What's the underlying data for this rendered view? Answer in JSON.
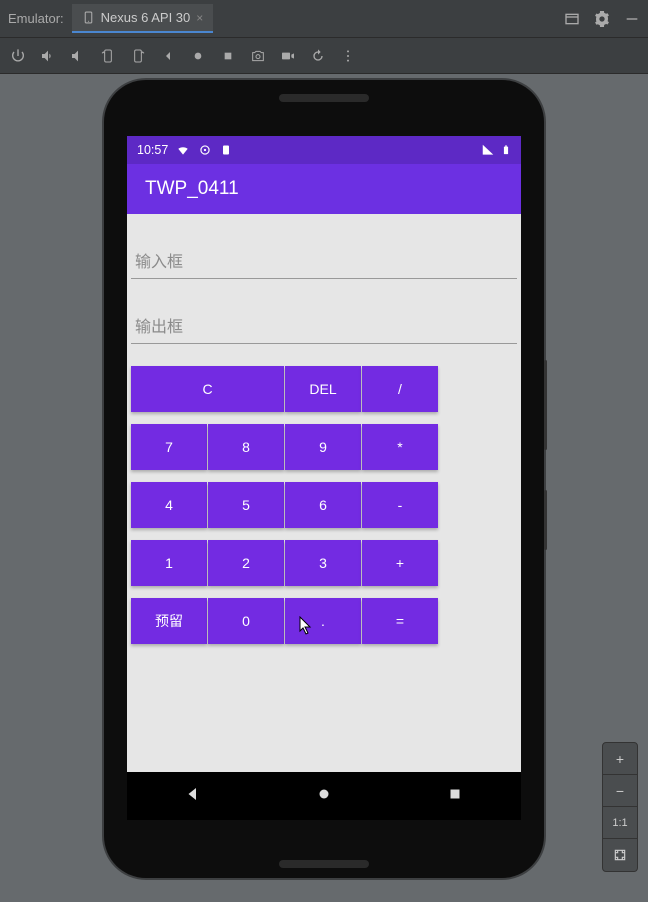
{
  "window": {
    "emulator_label": "Emulator:",
    "tab_title": "Nexus 6 API 30"
  },
  "status": {
    "time": "10:57"
  },
  "app": {
    "title": "TWP_0411",
    "input_placeholder": "输入框",
    "output_placeholder": "输出框"
  },
  "calc": {
    "rows": [
      [
        "C",
        "DEL",
        "/"
      ],
      [
        "7",
        "8",
        "9",
        "*"
      ],
      [
        "4",
        "5",
        "6",
        "-"
      ],
      [
        "1",
        "2",
        "3",
        "+"
      ],
      [
        "预留",
        "0",
        ".",
        "="
      ]
    ]
  },
  "zoom": {
    "ratio": "1:1"
  }
}
